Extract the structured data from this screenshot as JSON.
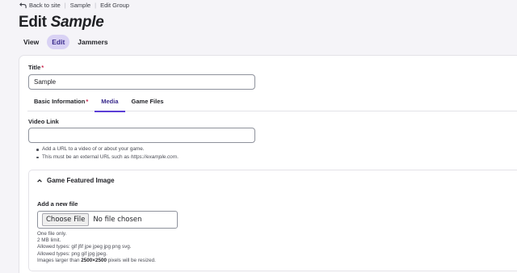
{
  "breadcrumb": {
    "back_label": "Back to site",
    "items": [
      "Sample",
      "Edit Group"
    ]
  },
  "page": {
    "title_prefix": "Edit",
    "title_name": "Sample"
  },
  "primary_tabs": [
    {
      "label": "View",
      "active": false
    },
    {
      "label": "Edit",
      "active": true
    },
    {
      "label": "Jammers",
      "active": false
    }
  ],
  "form": {
    "title_label": "Title",
    "required_mark": "*",
    "title_value": "Sample",
    "secondary_tabs": [
      {
        "label": "Basic Information",
        "required": true,
        "active": false
      },
      {
        "label": "Media",
        "required": false,
        "active": true
      },
      {
        "label": "Game Files",
        "required": false,
        "active": false
      }
    ],
    "video_link": {
      "label": "Video Link",
      "value": "",
      "help_1": "Add a URL to a video of or about your game.",
      "help_2_prefix": "This must be an external URL such as ",
      "help_2_example": "https://example.com",
      "help_2_suffix": "."
    },
    "featured_image": {
      "summary": "Game Featured Image",
      "add_label": "Add a new file",
      "choose_button": "Choose File",
      "no_file_text": "No file chosen",
      "help_lines": [
        "One file only.",
        "2 MB limit.",
        "Allowed types: gif jfif jpe jpeg jpg png svg.",
        "Allowed types: png gif jpg jpeg."
      ],
      "resize_prefix": "Images larger than ",
      "resize_dims": "2500×2500",
      "resize_suffix": " pixels will be resized."
    }
  },
  "colors": {
    "accent": "#5b3ed6",
    "active_tab_bg": "#d9d2f4",
    "required": "#c9224a"
  }
}
